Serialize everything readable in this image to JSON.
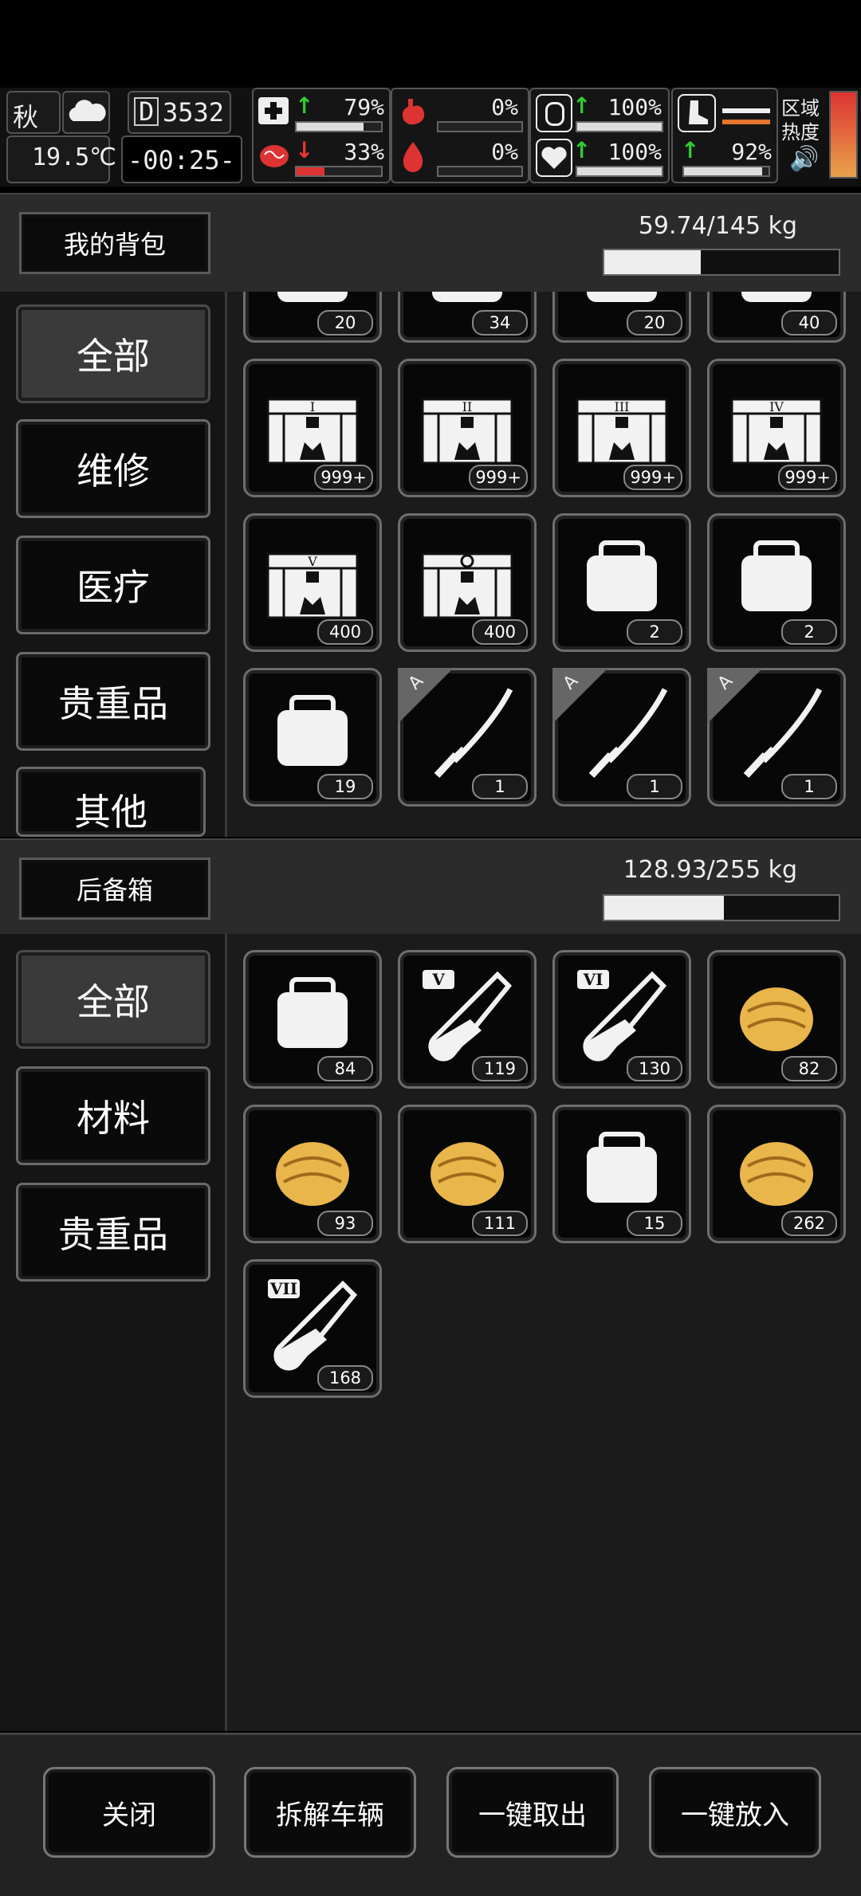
{
  "hud": {
    "season": "秋",
    "temperature": "19.5℃",
    "day": "3532",
    "time": "-00:25-",
    "stats": [
      {
        "name": "health",
        "trend": "up",
        "value": "79%",
        "level": 0.79
      },
      {
        "name": "hunger",
        "trend": "none",
        "value": "0%",
        "level": 0.0
      },
      {
        "name": "stamina",
        "trend": "up",
        "value": "100%",
        "level": 1.0
      },
      {
        "name": "sanity",
        "trend": "down",
        "value": "33%",
        "level": 0.33
      },
      {
        "name": "thirst",
        "trend": "none",
        "value": "0%",
        "level": 0.0
      },
      {
        "name": "mood",
        "trend": "up",
        "value": "100%",
        "level": 1.0
      },
      {
        "name": "leg",
        "trend": "up",
        "value": "92%",
        "level": 0.92
      }
    ],
    "region_heat_label_1": "区域",
    "region_heat_label_2": "热度"
  },
  "backpack": {
    "title": "我的背包",
    "weight": "59.74/145 kg",
    "weight_fill": 0.41,
    "categories": [
      "全部",
      "维修",
      "医疗",
      "贵重品",
      "其他"
    ],
    "items": [
      {
        "icon": "toolbox-icon",
        "count": "20"
      },
      {
        "icon": "spatula-tools-icon",
        "count": "34"
      },
      {
        "icon": "tool-bucket-icon",
        "count": "20"
      },
      {
        "icon": "sewing-kit-icon",
        "count": "40"
      },
      {
        "icon": "crate-tier-1-icon",
        "tier": "I",
        "count": "999+"
      },
      {
        "icon": "crate-tier-2-icon",
        "tier": "II",
        "count": "999+"
      },
      {
        "icon": "crate-tier-3-icon",
        "tier": "III",
        "count": "999+"
      },
      {
        "icon": "crate-tier-4-icon",
        "tier": "IV",
        "count": "999+"
      },
      {
        "icon": "crate-tier-5-icon",
        "tier": "V",
        "count": "400"
      },
      {
        "icon": "crate-special-icon",
        "tier": "",
        "count": "400"
      },
      {
        "icon": "bandage-roll-icon",
        "count": "2"
      },
      {
        "icon": "stick-icon",
        "count": "2"
      },
      {
        "icon": "rope-hook-icon",
        "count": "19"
      },
      {
        "icon": "katana-icon",
        "grade": "A",
        "count": "1"
      },
      {
        "icon": "katana-icon",
        "grade": "A",
        "count": "1"
      },
      {
        "icon": "katana-icon",
        "grade": "A",
        "count": "1"
      }
    ]
  },
  "trunk": {
    "title": "后备箱",
    "weight": "128.93/255 kg",
    "weight_fill": 0.51,
    "categories": [
      "全部",
      "材料",
      "贵重品"
    ],
    "items": [
      {
        "icon": "cloth-roll-icon",
        "count": "84"
      },
      {
        "icon": "test-tube-v-icon",
        "tier": "V",
        "count": "119"
      },
      {
        "icon": "test-tube-vi-icon",
        "tier": "VI",
        "count": "130"
      },
      {
        "icon": "gold-thread-spool-icon",
        "count": "82"
      },
      {
        "icon": "gold-fabric-icon",
        "count": "93"
      },
      {
        "icon": "gold-spool-icon",
        "count": "111"
      },
      {
        "icon": "leather-roll-icon",
        "count": "15"
      },
      {
        "icon": "gold-ore-icon",
        "count": "262"
      },
      {
        "icon": "test-tube-vii-icon",
        "tier": "VII",
        "count": "168"
      }
    ]
  },
  "buttons": {
    "close": "关闭",
    "dismantle": "拆解车辆",
    "take_all": "一键取出",
    "put_all": "一键放入"
  }
}
